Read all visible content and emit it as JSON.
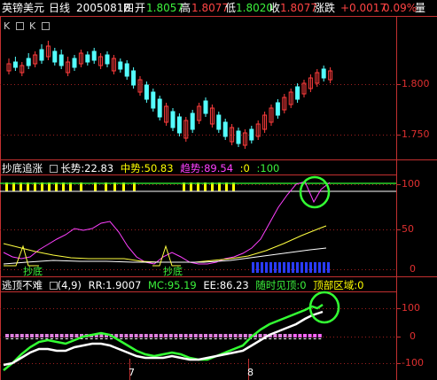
{
  "header": {
    "symbol": "英镑美元",
    "period": "日线",
    "date": "20050818",
    "weekday": "四",
    "open_label": "开",
    "open": "1.8057",
    "high_label": "高",
    "high": "1.8077",
    "low_label": "低",
    "low": "1.8020",
    "close_label": "收",
    "close": "1.8077",
    "change_label": "涨跌",
    "change": "+0.0017",
    "change_pct": "0.09%",
    "volume_label": "量"
  },
  "toolbar": {
    "k1": "K",
    "box1": "",
    "k2": "K",
    "box2": ""
  },
  "main_panel": {
    "y_ticks": [
      "1.800",
      "1.750"
    ]
  },
  "indicator1": {
    "name": "抄底追涨",
    "box": "",
    "long_label": "长势",
    "long_value": ":22.83",
    "mid_label": "中势",
    "mid_value": ":50.83",
    "trend_label": "趋势",
    "trend_value": ":89.54",
    "v0": ":0",
    "v100": ":100",
    "y_ticks": [
      "100",
      "50",
      "0"
    ],
    "note1": "抄底",
    "note2": "抄底"
  },
  "indicator2": {
    "name": "逃顶不难",
    "params": "(4,9)",
    "rr_label": "RR",
    "rr_value": ":1.9007",
    "mc_label": "MC",
    "mc_value": ":95.19",
    "ee_label": "EE",
    "ee_value": ":86.23",
    "see_top_label": "随时见顶",
    "see_top_value": ":0",
    "top_zone_label": "顶部区域",
    "top_zone_value": ":0",
    "y_ticks": [
      "100",
      "0",
      "-100"
    ]
  },
  "x_axis": {
    "labels": [
      "7",
      "8"
    ]
  },
  "colors": {
    "up": "#ff3c3c",
    "down": "#54ffff",
    "grid": "#d43030",
    "highlight": "#33ff33"
  }
}
